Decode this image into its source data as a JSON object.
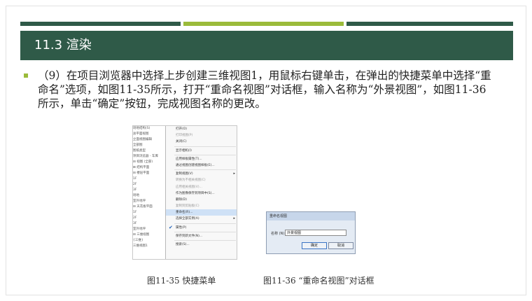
{
  "slide": {
    "title": "11.3  渲染",
    "paragraph": "（9）在项目浏览器中选择上步创建三维视图1，用鼠标右键单击，在弹出的快捷菜单中选择“重命名”选项，如图11-35所示，打开“重命名视图”对话框，输入名称为“外景视图”，如图11-36所示，单击“确定”按钮，完成视图名称的更改。"
  },
  "figure1": {
    "caption": "图11-35 快捷菜单",
    "tree": [
      "场地结构(S)",
      "总平面视图",
      "立面视图编辑",
      "全部图",
      "图纸类型",
      "项目浏览器 - 车库",
      "⊟ 视图 (全部)",
      "⊞ 结构平面",
      "⊟ 楼层平面",
      "1F",
      "2F",
      "3F",
      "场地",
      "室外地坪",
      "⊟ 天花板平面",
      "1F",
      "2F",
      "3F",
      "室外地坪",
      "⊟ 三维视图",
      "{三维}",
      "三维视图1"
    ],
    "menu": [
      {
        "label": "打开(O)",
        "dim": false
      },
      {
        "label": "打印视图(P)",
        "dim": true
      },
      {
        "label": "关闭(C)",
        "dim": false
      },
      {
        "sep": true
      },
      {
        "label": "显示相机(I)",
        "dim": false
      },
      {
        "sep": true
      },
      {
        "label": "应用样板属性(T)...",
        "dim": false
      },
      {
        "label": "通过视图创建视图样板(E)...",
        "dim": false
      },
      {
        "sep": true
      },
      {
        "label": "复制视图(V)",
        "dim": false,
        "arrow": true
      },
      {
        "label": "转换为不相关视图(C)",
        "dim": true
      },
      {
        "label": "应用相关视图(V)...",
        "dim": true
      },
      {
        "label": "作为图像保存到项目中(S)...",
        "dim": false
      },
      {
        "label": "删除(D)",
        "dim": false
      },
      {
        "label": "复制到剪贴板(C)",
        "dim": true
      },
      {
        "label": "重命名(R)...",
        "dim": false,
        "selected": true
      },
      {
        "label": "选择全部实例(A)",
        "dim": false,
        "arrow": true
      },
      {
        "sep": true
      },
      {
        "label": "属性(P)",
        "dim": false,
        "check": true
      },
      {
        "sep": true
      },
      {
        "label": "保存到新文件(N)...",
        "dim": false
      },
      {
        "sep": true
      },
      {
        "label": "搜索(S)...",
        "dim": false
      }
    ]
  },
  "figure2": {
    "caption": "图11-36 “重命名视图”对话框",
    "dialog_title": "重命名视图",
    "label": "名称 (N):",
    "value": "外景视图",
    "ok": "确定",
    "cancel": "取消"
  }
}
